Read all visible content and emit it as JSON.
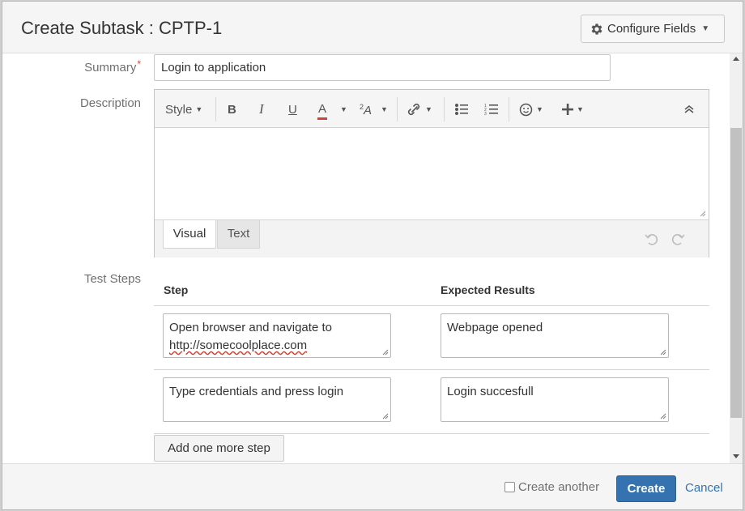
{
  "dialog": {
    "title": "Create Subtask : CPTP-1",
    "configure_fields_label": "Configure Fields"
  },
  "summary": {
    "label": "Summary",
    "required_marker": "*",
    "value": "Login to application"
  },
  "description": {
    "label": "Description",
    "toolbar": {
      "style_label": "Style",
      "bold": "B",
      "italic": "I",
      "underline": "U",
      "text_color": "A"
    },
    "tabs": [
      "Visual",
      "Text"
    ],
    "active_tab": "Visual"
  },
  "test_steps": {
    "label": "Test Steps",
    "columns": [
      "Step",
      "Expected Results"
    ],
    "rows": [
      {
        "step_line1": "Open browser and navigate to",
        "step_link": "http://somecoolplace.com",
        "expected": "Webpage opened"
      },
      {
        "step": "Type credentials and press login",
        "expected": "Login succesfull"
      }
    ],
    "add_step_label": "Add one more step"
  },
  "footer": {
    "create_another_label": "Create another",
    "create_another_checked": false,
    "create_label": "Create",
    "cancel_label": "Cancel"
  },
  "colors": {
    "primary": "#3572b0",
    "required": "#d04437"
  }
}
